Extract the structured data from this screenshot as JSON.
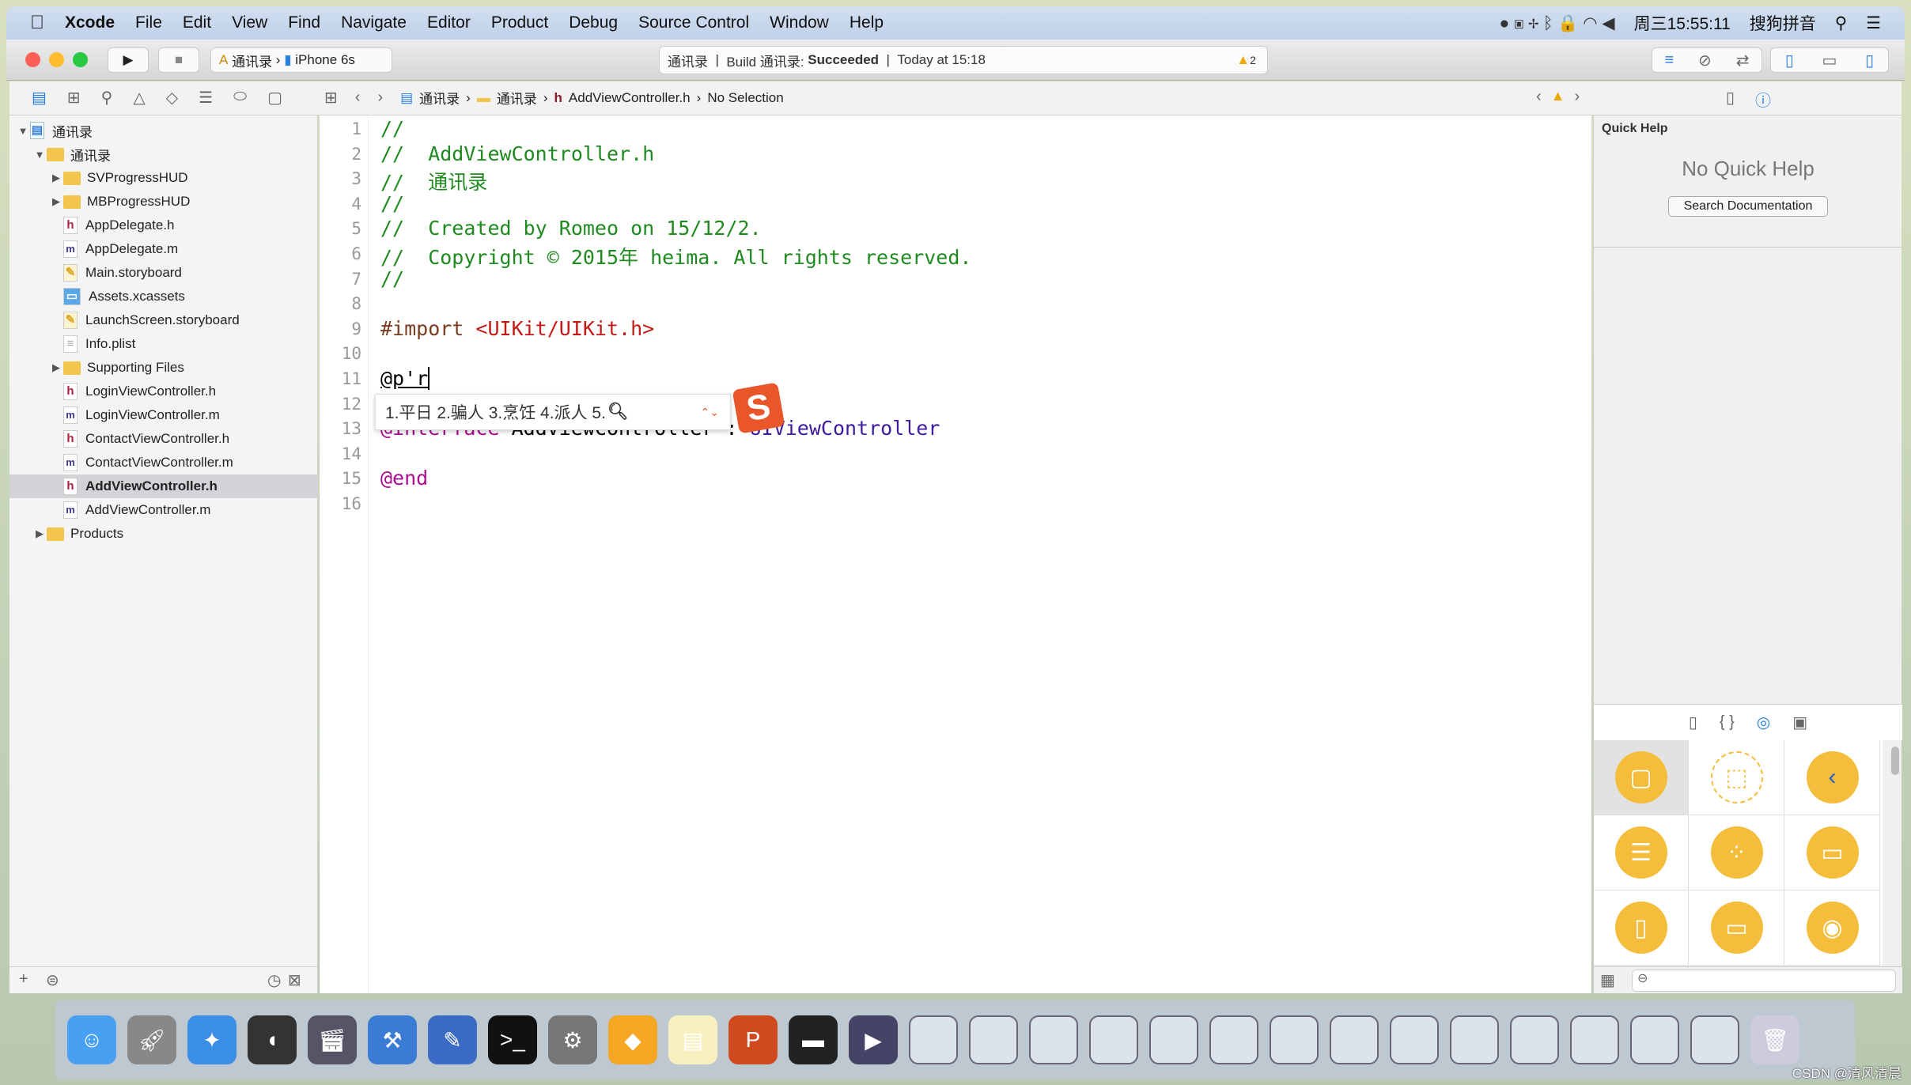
{
  "menubar": {
    "app": "Xcode",
    "items": [
      "File",
      "Edit",
      "View",
      "Find",
      "Navigate",
      "Editor",
      "Product",
      "Debug",
      "Source Control",
      "Window",
      "Help"
    ],
    "clock": "周三15:55:11",
    "ime": "搜狗拼音"
  },
  "toolbar": {
    "scheme": "通讯录",
    "device": "iPhone 6s",
    "status_project": "通讯录",
    "status_build": "Build 通讯录:",
    "status_result": "Succeeded",
    "status_time": "Today at 15:18",
    "warnings": "2"
  },
  "jumpbar": {
    "crumbs": [
      "通讯录",
      "通讯录",
      "AddViewController.h",
      "No Selection"
    ]
  },
  "navigator": {
    "items": [
      {
        "label": "通讯录",
        "type": "project",
        "level": 0,
        "open": true
      },
      {
        "label": "通讯录",
        "type": "folder",
        "level": 1,
        "open": true
      },
      {
        "label": "SVProgressHUD",
        "type": "folder",
        "level": 2,
        "open": false
      },
      {
        "label": "MBProgressHUD",
        "type": "folder",
        "level": 2,
        "open": false
      },
      {
        "label": "AppDelegate.h",
        "type": "h",
        "level": 2
      },
      {
        "label": "AppDelegate.m",
        "type": "m",
        "level": 2
      },
      {
        "label": "Main.storyboard",
        "type": "sb",
        "level": 2
      },
      {
        "label": "Assets.xcassets",
        "type": "assets",
        "level": 2
      },
      {
        "label": "LaunchScreen.storyboard",
        "type": "sb",
        "level": 2
      },
      {
        "label": "Info.plist",
        "type": "plist",
        "level": 2
      },
      {
        "label": "Supporting Files",
        "type": "folder",
        "level": 2,
        "open": false
      },
      {
        "label": "LoginViewController.h",
        "type": "h",
        "level": 2
      },
      {
        "label": "LoginViewController.m",
        "type": "m",
        "level": 2
      },
      {
        "label": "ContactViewController.h",
        "type": "h",
        "level": 2
      },
      {
        "label": "ContactViewController.m",
        "type": "m",
        "level": 2
      },
      {
        "label": "AddViewController.h",
        "type": "h",
        "level": 2,
        "selected": true
      },
      {
        "label": "AddViewController.m",
        "type": "m",
        "level": 2
      },
      {
        "label": "Products",
        "type": "folder",
        "level": 1,
        "open": false
      }
    ]
  },
  "editor": {
    "lines": [
      [
        [
          "cm",
          "//"
        ]
      ],
      [
        [
          "cm",
          "//  AddViewController.h"
        ]
      ],
      [
        [
          "cm",
          "//  通讯录"
        ]
      ],
      [
        [
          "cm",
          "//"
        ]
      ],
      [
        [
          "cm",
          "//  Created by Romeo on 15/12/2."
        ]
      ],
      [
        [
          "cm",
          "//  Copyright © 2015年 heima. All rights reserved."
        ]
      ],
      [
        [
          "cm",
          "//"
        ]
      ],
      [],
      [
        [
          "pp",
          "#import "
        ],
        [
          "str",
          "<UIKit/UIKit.h>"
        ]
      ],
      [],
      [
        [
          "",
          "@p'r"
        ]
      ],
      [],
      [
        [
          "kw",
          "@interface"
        ],
        [
          "",
          " AddViewController : "
        ],
        [
          "cls",
          "UIViewController"
        ]
      ],
      [],
      [
        [
          "kw",
          "@end"
        ]
      ],
      []
    ]
  },
  "ime_popup": {
    "candidates": "1.平日 2.骗人 3.烹饪 4.派人 5."
  },
  "inspector": {
    "title": "Quick Help",
    "empty": "No Quick Help",
    "search_button": "Search Documentation"
  },
  "library": {
    "items": [
      "view-controller",
      "storyboard-reference",
      "navigation-controller",
      "table-view-controller",
      "collection-view-controller",
      "tab-bar-controller",
      "split-view-controller",
      "page-view-controller",
      "glkit-view-controller"
    ]
  },
  "colors": {
    "accent": "#f4bd3c",
    "comment": "#1f8a1f",
    "keyword": "#aa0d91",
    "selection": "#d4d4d8"
  },
  "watermark": "CSDN @清风清晨"
}
